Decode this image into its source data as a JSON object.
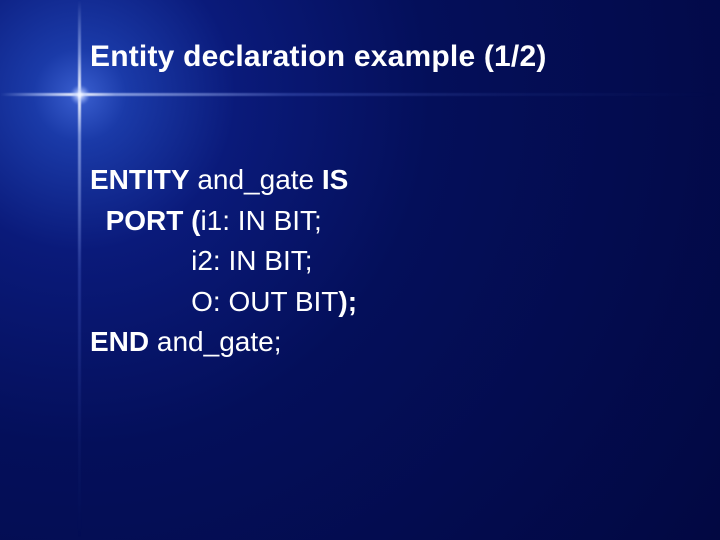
{
  "slide": {
    "title": "Entity declaration example (1/2)",
    "code": {
      "kw_entity": "ENTITY",
      "entity_name": " and_gate ",
      "kw_is": "IS",
      "kw_port_open": "PORT (",
      "port1": "i1: IN BIT;",
      "port2": "i2: IN BIT;",
      "port3_pre": "O: OUT BIT",
      "kw_close": ");",
      "kw_end": "END",
      "end_name": " and_gate;"
    }
  }
}
